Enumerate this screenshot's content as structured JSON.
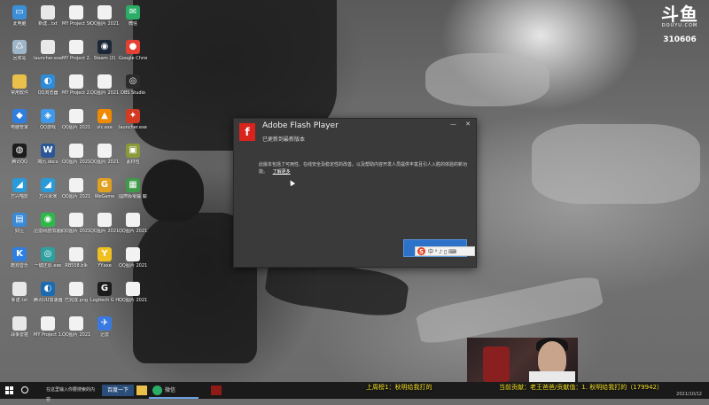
{
  "desktop": {
    "icons": [
      {
        "label": "此电脑",
        "name": "this-pc-icon",
        "color": "#3b8fd6",
        "glyph": "▭"
      },
      {
        "label": "新建...txt",
        "name": "text-file-icon",
        "color": "#e8e8e8",
        "glyph": ""
      },
      {
        "label": "MY Project Steam",
        "name": "file-icon",
        "color": "#f2f2f2",
        "glyph": ""
      },
      {
        "label": "QQ图片 2021...",
        "name": "image-file-icon",
        "color": "#f2f2f2",
        "glyph": ""
      },
      {
        "label": "微信",
        "name": "wechat-icon",
        "color": "#2aae67",
        "glyph": "✉"
      },
      {
        "label": "回收站",
        "name": "recycle-bin-icon",
        "color": "#9fb5c8",
        "glyph": "♺"
      },
      {
        "label": "launcher.exe",
        "name": "exe-file-icon",
        "color": "#e8e8e8",
        "glyph": ""
      },
      {
        "label": "MY Project 2.9thumb",
        "name": "file-icon",
        "color": "#f2f2f2",
        "glyph": ""
      },
      {
        "label": "Steam (2)",
        "name": "steam-icon",
        "color": "#1b2838",
        "glyph": "◉"
      },
      {
        "label": "Google Chrome",
        "name": "chrome-icon",
        "color": "#e34133",
        "glyph": "●"
      },
      {
        "label": "常用软件",
        "name": "folder-icon",
        "color": "#e8c04a",
        "glyph": ""
      },
      {
        "label": "QQ浏览器",
        "name": "qq-browser-icon",
        "color": "#2e8bd6",
        "glyph": "◐"
      },
      {
        "label": "MY Project 2.wfe",
        "name": "file-icon",
        "color": "#f2f2f2",
        "glyph": ""
      },
      {
        "label": "QQ图片 2021...",
        "name": "image-file-icon",
        "color": "#f2f2f2",
        "glyph": ""
      },
      {
        "label": "OBS Studio",
        "name": "obs-icon",
        "color": "#2b2b2b",
        "glyph": "◎"
      },
      {
        "label": "电脑管家",
        "name": "pc-manager-icon",
        "color": "#2f7fe0",
        "glyph": "◆"
      },
      {
        "label": "QQ游戏",
        "name": "qq-game-icon",
        "color": "#3e9ae8",
        "glyph": "◈"
      },
      {
        "label": "QQ图片 2021...",
        "name": "image-file-icon",
        "color": "#f2f2f2",
        "glyph": ""
      },
      {
        "label": "vlc.exe",
        "name": "vlc-icon",
        "color": "#f08a00",
        "glyph": "▲"
      },
      {
        "label": "launcher.exe (2)",
        "name": "launcher-icon",
        "color": "#d23b22",
        "glyph": "✦"
      },
      {
        "label": "腾讯QQ",
        "name": "qq-icon",
        "color": "#1c1c1c",
        "glyph": "◍"
      },
      {
        "label": "简历.docx",
        "name": "word-doc-icon",
        "color": "#2b5797",
        "glyph": "W"
      },
      {
        "label": "QQ图片 2021...",
        "name": "image-file-icon",
        "color": "#f2f2f2",
        "glyph": ""
      },
      {
        "label": "QQ图片 2021...",
        "name": "image-file-icon",
        "color": "#f2f2f2",
        "glyph": ""
      },
      {
        "label": "素材包",
        "name": "archive-icon",
        "color": "#8a9a3a",
        "glyph": "▣"
      },
      {
        "label": "万兴喵影",
        "name": "app-icon",
        "color": "#2a9ad8",
        "glyph": "◢"
      },
      {
        "label": "万兴录演",
        "name": "app-icon",
        "color": "#2a9ad8",
        "glyph": "◢"
      },
      {
        "label": "QQ图片 2021...",
        "name": "image-file-icon",
        "color": "#f2f2f2",
        "glyph": ""
      },
      {
        "label": "WeGame",
        "name": "wegame-icon",
        "color": "#e0a020",
        "glyph": "G"
      },
      {
        "label": "國際版電腦 開打遊戲",
        "name": "game-icon",
        "color": "#3f9a4a",
        "glyph": "▦"
      },
      {
        "label": "好压",
        "name": "zip-icon",
        "color": "#3a8ad8",
        "glyph": "▤"
      },
      {
        "label": "迅雷网游加速器",
        "name": "accelerator-icon",
        "color": "#2fb84a",
        "glyph": "◉"
      },
      {
        "label": "QQ图片 2021...",
        "name": "image-file-icon",
        "color": "#f2f2f2",
        "glyph": ""
      },
      {
        "label": "QQ图片 2021...",
        "name": "image-file-icon",
        "color": "#f2f2f2",
        "glyph": ""
      },
      {
        "label": "QQ图片 2021...",
        "name": "image-file-icon",
        "color": "#f2f2f2",
        "glyph": ""
      },
      {
        "label": "酷狗音乐",
        "name": "kugou-icon",
        "color": "#2f7fe0",
        "glyph": "K"
      },
      {
        "label": "一键还原.exe",
        "name": "restore-icon",
        "color": "#2fa0a0",
        "glyph": "◎"
      },
      {
        "label": "RB558.blk",
        "name": "file-icon",
        "color": "#f2f2f2",
        "glyph": ""
      },
      {
        "label": "YY.exe",
        "name": "yy-icon",
        "color": "#f0c020",
        "glyph": "Y"
      },
      {
        "label": "QQ图片 2021...",
        "name": "image-file-icon",
        "color": "#f2f2f2",
        "glyph": ""
      },
      {
        "label": "新建.txt",
        "name": "text-file-icon",
        "color": "#e8e8e8",
        "glyph": ""
      },
      {
        "label": "腾讯UU加速器",
        "name": "uu-icon",
        "color": "#1c6ab0",
        "glyph": "◐"
      },
      {
        "label": "已完成.png",
        "name": "image-file-icon",
        "color": "#f2f2f2",
        "glyph": ""
      },
      {
        "label": "Logitech G HUB",
        "name": "logitech-icon",
        "color": "#1c1c1c",
        "glyph": "G"
      },
      {
        "label": "QQ图片 2021...",
        "name": "image-file-icon",
        "color": "#f2f2f2",
        "glyph": ""
      },
      {
        "label": "战争雷霆",
        "name": "file-icon",
        "color": "#e8e8e8",
        "glyph": ""
      },
      {
        "label": "MY Project 1.5thumb",
        "name": "file-icon",
        "color": "#f2f2f2",
        "glyph": ""
      },
      {
        "label": "QQ图片 2021...",
        "name": "image-file-icon",
        "color": "#f2f2f2",
        "glyph": ""
      },
      {
        "label": "迅雷",
        "name": "xunlei-icon",
        "color": "#3a7ae0",
        "glyph": "✈"
      }
    ]
  },
  "branding": {
    "logo": "斗鱼",
    "sub": "DOUYU.COM",
    "room": "310606"
  },
  "dialog": {
    "title": "Adobe Flash Player",
    "subtitle": "已更新到最新版本",
    "body": "此版本包括了可用性、在线安全及稳定性的改善。以及帮助内容开发人员提供丰富且引人入胜的体验的新功能。",
    "link": "了解更多",
    "logo_letter": "f",
    "minimize": "—",
    "close": "✕"
  },
  "ime": {
    "s": "S",
    "tools": "中 ⁰ ♪ ▯ ⌨"
  },
  "overlay": {
    "ticker_left": "上周榜1：秋明给我打的",
    "ticker_right": "当前贡献：老王爸爸/贡献值：1. 秋明给我打的（179942）"
  },
  "taskbar": {
    "search": "在这里输入你要搜索的内容",
    "button": "百度一下",
    "wechat": "微信",
    "date": "2021/10/12"
  }
}
